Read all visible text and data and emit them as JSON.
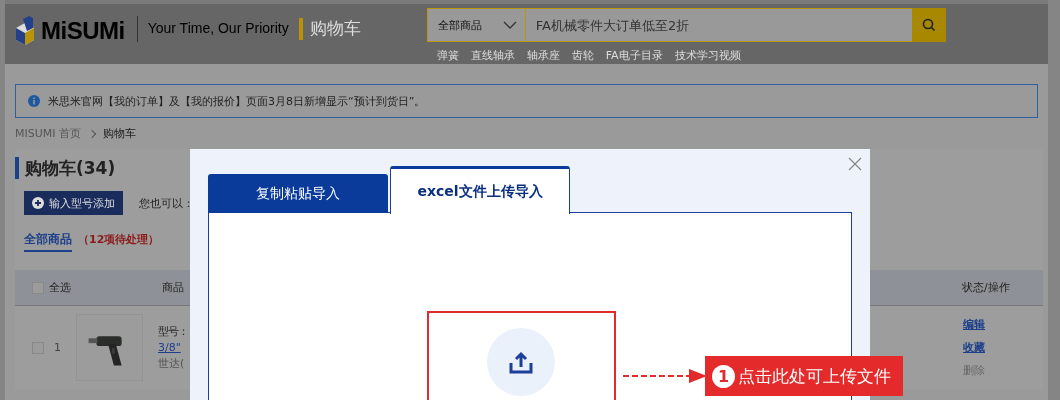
{
  "header": {
    "logo": "MiSUMi",
    "slogan": "Your Time, Our Priority",
    "page_title": "购物车",
    "search": {
      "category": "全部商品",
      "placeholder": "FA机械零件大订单低至2折"
    },
    "quick_links": [
      "弹簧",
      "直线轴承",
      "轴承座",
      "齿轮",
      "FA电子目录",
      "技术学习视频"
    ]
  },
  "notice": "米思米官网【我的订单】及【我的报价】页面3月8日新增显示“预计到货日”。",
  "breadcrumb": [
    "MISUMI 首页",
    "购物车"
  ],
  "cart": {
    "title": "购物车(34)",
    "add_button": "输入型号添加",
    "also_label": "您也可以：",
    "tabs": [
      {
        "label": "全部商品",
        "note": "（12项待处理）",
        "selected": true
      }
    ],
    "select_all": {
      "label": "全选",
      "checked": false
    },
    "columns": [
      "商品",
      "状态/操作"
    ],
    "rows": [
      {
        "checked": false,
        "index": "1",
        "model_label": "型号：",
        "name": "3/8\"",
        "brand": "世达(",
        "actions": [
          {
            "label": "编辑",
            "kind": "link"
          },
          {
            "label": "收藏",
            "kind": "link"
          },
          {
            "label": "删除",
            "kind": "muted"
          }
        ]
      }
    ]
  },
  "dialog": {
    "tabs": [
      {
        "label": "复制粘贴导入",
        "selected": false
      },
      {
        "label": "excel文件上传导入",
        "selected": true
      }
    ],
    "callout": {
      "number": "1",
      "text": "点击此处可上传文件"
    }
  }
}
